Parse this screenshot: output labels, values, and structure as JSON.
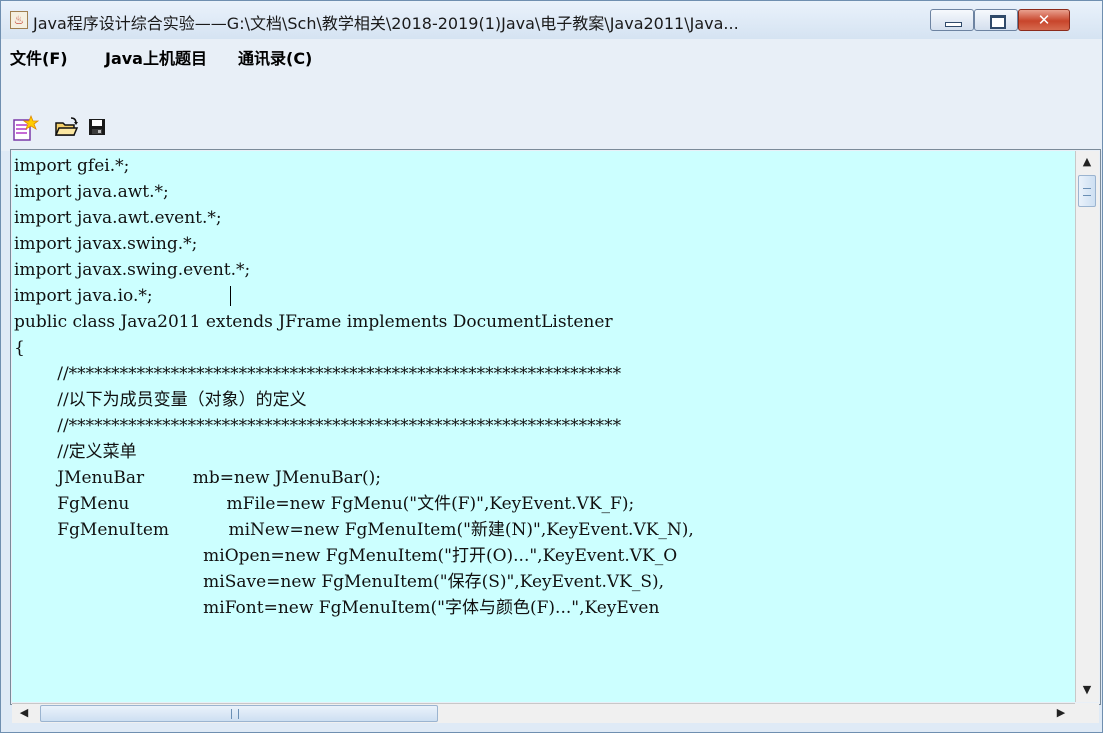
{
  "window": {
    "title": "Java程序设计综合实验——G:\\文档\\Sch\\教学相关\\2018-2019(1)Java\\电子教案\\Java2011\\Java...",
    "minimize_glyph": "",
    "maximize_glyph": "",
    "close_glyph": "✕"
  },
  "menubar": {
    "items": [
      {
        "label": "文件(F)"
      },
      {
        "label": "Java上机题目"
      },
      {
        "label": "通讯录(C)"
      }
    ]
  },
  "toolbar": {
    "buttons": [
      {
        "icon": "new-file-icon"
      },
      {
        "icon": "open-folder-icon"
      },
      {
        "icon": "save-disk-icon"
      }
    ]
  },
  "editor": {
    "lines": [
      "import gfei.*;",
      "import java.awt.*;",
      "import java.awt.event.*;",
      "import javax.swing.*;",
      "import javax.swing.event.*;",
      "import java.io.*;",
      "public class Java2011 extends JFrame implements DocumentListener",
      "{",
      "        //*****************************************************************",
      "        //以下为成员变量（对象）的定义",
      "        //*****************************************************************",
      "        //定义菜单",
      "        JMenuBar         mb=new JMenuBar();",
      "        FgMenu                  mFile=new FgMenu(\"文件(F)\",KeyEvent.VK_F);",
      "        FgMenuItem           miNew=new FgMenuItem(\"新建(N)\",KeyEvent.VK_N),",
      "                                   miOpen=new FgMenuItem(\"打开(O)...\",KeyEvent.VK_O",
      "                                   miSave=new FgMenuItem(\"保存(S)\",KeyEvent.VK_S),",
      "                                   miFont=new FgMenuItem(\"字体与颜色(F)...\",KeyEven"
    ],
    "background": "#ccffff"
  },
  "colors": {
    "titlebar": "#d5e3f2",
    "chrome": "#e8eff7",
    "close_button": "#c8452b"
  }
}
